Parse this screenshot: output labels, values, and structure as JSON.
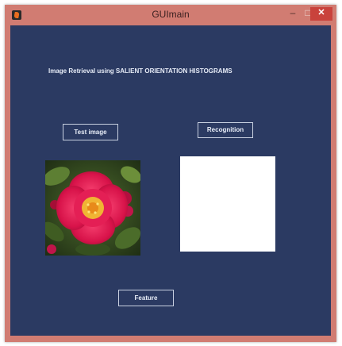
{
  "window": {
    "title": "GUImain",
    "minimize_glyph": "–",
    "maximize_glyph": "□",
    "close_glyph": "✕"
  },
  "icons": {
    "app": "matlab-icon"
  },
  "colors": {
    "window_frame": "#d17c72",
    "figure_background": "#2b3a62",
    "close_button": "#c9423c",
    "text": "#e7ecf7"
  },
  "main": {
    "heading": "Image Retrieval using SALIENT ORIENTATION HISTOGRAMS",
    "test_image_label": "Test image",
    "recognition_label": "Recognition",
    "feature_label": "Feature"
  }
}
